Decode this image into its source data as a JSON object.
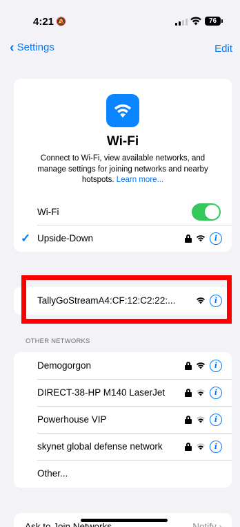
{
  "status_bar": {
    "time": "4:21",
    "battery": "76"
  },
  "nav": {
    "back_label": "Settings",
    "edit_label": "Edit"
  },
  "header": {
    "title": "Wi-Fi",
    "description": "Connect to Wi-Fi, view available networks, and manage settings for joining networks and nearby hotspots.",
    "learn_more": "Learn more..."
  },
  "wifi_toggle": {
    "label": "Wi-Fi",
    "on": true
  },
  "connected": {
    "name": "Upside-Down"
  },
  "current_network": {
    "name": "TallyGoStreamA4:CF:12:C2:22:..."
  },
  "other_networks": {
    "header": "OTHER NETWORKS",
    "items": [
      {
        "name": "Demogorgon"
      },
      {
        "name": "DIRECT-38-HP M140 LaserJet"
      },
      {
        "name": "Powerhouse VIP"
      },
      {
        "name": "skynet global defense network"
      }
    ],
    "other_label": "Other..."
  },
  "ask_to_join": {
    "label": "Ask to Join Networks",
    "value": "Notify"
  },
  "colors": {
    "accent": "#007aff",
    "toggle_on": "#34c759",
    "highlight": "#ff0000",
    "wifi_icon_bg": "#0a84ff"
  }
}
